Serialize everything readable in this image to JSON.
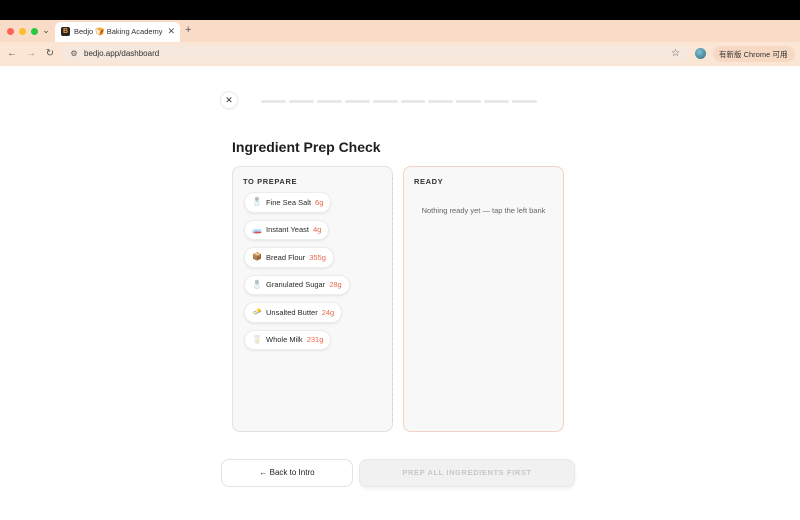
{
  "browser": {
    "tab_title": "Bedjo 🍞 Baking Academy",
    "url": "bedjo.app/dashboard",
    "update_label": "有新版 Chrome 可用"
  },
  "progress": {
    "total_steps": 10,
    "completed_steps": 0
  },
  "page": {
    "title": "Ingredient Prep Check"
  },
  "left_panel": {
    "heading": "TO PREPARE",
    "items": [
      {
        "icon": "salt-shaker-icon",
        "glyph": "🧂",
        "name": "Fine Sea Salt",
        "qty": "6g"
      },
      {
        "icon": "yeast-packet-icon",
        "glyph": "🧫",
        "name": "Instant Yeast",
        "qty": "4g"
      },
      {
        "icon": "flour-bag-icon",
        "glyph": "📦",
        "name": "Bread Flour",
        "qty": "355g"
      },
      {
        "icon": "sugar-shaker-icon",
        "glyph": "🧂",
        "name": "Granulated Sugar",
        "qty": "28g"
      },
      {
        "icon": "butter-icon",
        "glyph": "🧈",
        "name": "Unsalted Butter",
        "qty": "24g"
      },
      {
        "icon": "milk-carton-icon",
        "glyph": "🥛",
        "name": "Whole Milk",
        "qty": "231g"
      }
    ]
  },
  "right_panel": {
    "heading": "READY",
    "empty_message": "Nothing ready yet — tap the left bank"
  },
  "buttons": {
    "back_label": "← Back to Intro",
    "prep_label": "PREP ALL INGREDIENTS FIRST"
  },
  "colors": {
    "accent": "#e8664a",
    "tab_bar": "#f9dcc7",
    "ready_border": "#f3d2c6"
  }
}
